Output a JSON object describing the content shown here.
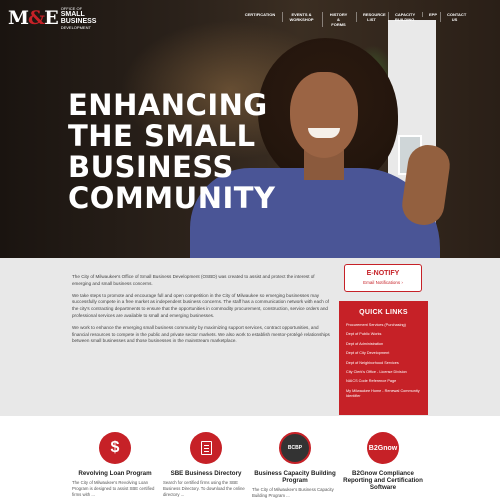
{
  "brand": {
    "logo_mark": "M&E",
    "logo_line1": "OFFICE OF",
    "logo_line2": "SMALL",
    "logo_line3": "BUSINESS",
    "logo_line4": "DEVELOPMENT",
    "accent_color": "#c62127"
  },
  "nav": {
    "items": [
      {
        "label": "CERTIFICATION"
      },
      {
        "label": "EVENTS &\nWORKSHOP"
      },
      {
        "label": "HISTORY &\nFORMS"
      },
      {
        "label": "RESOURCE\nLIST"
      },
      {
        "label": "CAPACITY\nBUILDING"
      },
      {
        "label": "EPP"
      },
      {
        "label": "CONTACT\nUS"
      }
    ]
  },
  "hero": {
    "title_lines": [
      "ENHANCING",
      "THE SMALL",
      "BUSINESS",
      "COMMUNITY"
    ]
  },
  "intro": {
    "paragraphs": [
      "The City of Milwaukee's Office of Small Business Development (OSBD) was created to assist and protect the interest of emerging and small business concerns.",
      "We take steps to promote and encourage full and open competition in the City of Milwaukee so emerging businesses may successfully compete in a free market as independent business concerns. The staff has a communication network with each of the city's contracting departments to ensure that the opportunities in commodity procurement, construction, service orders and professional services are available to small and emerging businesses.",
      "We work to enhance the emerging small business community by maximizing support services, contract opportunities, and financial resources to compete in the public and private sector markets. We also work to establish mentor-protégé relationships between small businesses and those businesses in the mainstream marketplace."
    ]
  },
  "enotify": {
    "title": "E-NOTIFY",
    "subtitle": "Email Notifications ›"
  },
  "quick_links": {
    "title": "QUICK LINKS",
    "items": [
      "Procurement Services (Purchasing)",
      "Dept of Public Works",
      "Dept of Administration",
      "Dept of City Development",
      "Dept of Neighborhood Services",
      "City Clerk's Office - License Division",
      "NAICS Code Reference Page",
      "My Milwaukee Home - Renewal Community Identifier"
    ]
  },
  "tiles": [
    {
      "icon": "dollar-icon",
      "glyph": "$",
      "title": "Revolving Loan Program",
      "desc": "The City of Milwaukee's Revolving Loan Program is designed to assist SBE certified firms with ..."
    },
    {
      "icon": "document-icon",
      "title": "SBE Business Directory",
      "desc": "Search for certified firms using the SBE Business Directory. To download the online directory ..."
    },
    {
      "icon": "bcbp-seal-icon",
      "glyph": "BCBP",
      "title": "Business Capacity Building Program",
      "desc": "The City of Milwaukee's Business Capacity Building Program ..."
    },
    {
      "icon": "b2gnow-icon",
      "glyph": "B2Gnow",
      "title": "B2Gnow Compliance Reporting and Certification Software",
      "desc": ""
    }
  ]
}
